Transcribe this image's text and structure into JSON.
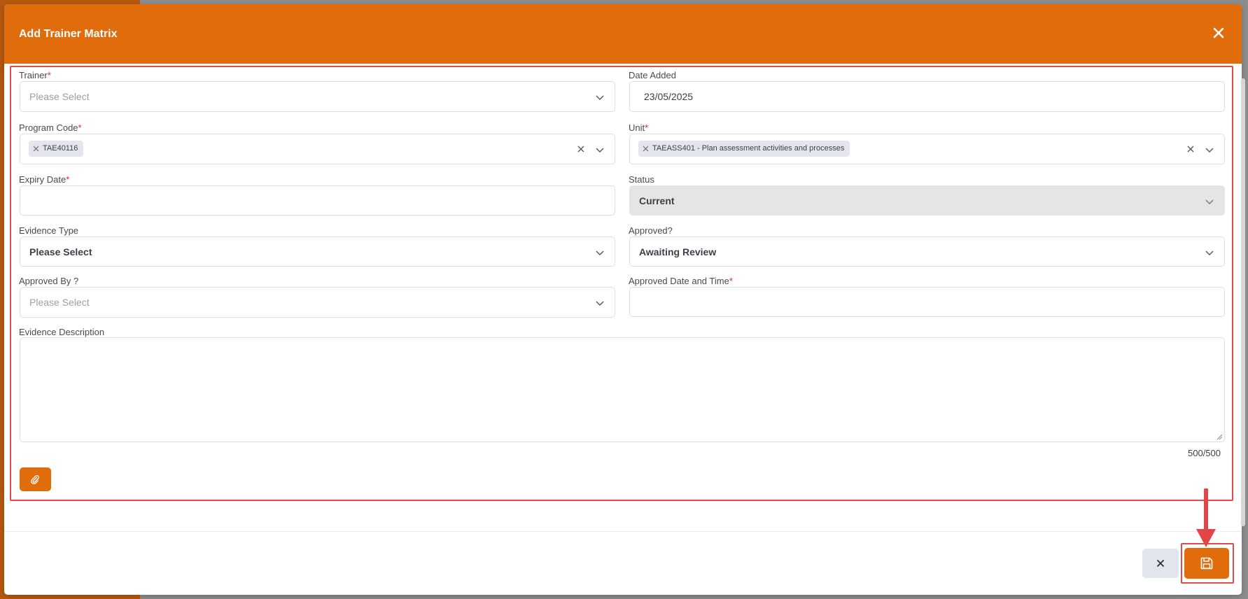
{
  "modal": {
    "title": "Add Trainer Matrix",
    "close_icon": "close-icon"
  },
  "form": {
    "trainer": {
      "label": "Trainer",
      "required_mark": "*",
      "placeholder": "Please Select"
    },
    "date_added": {
      "label": "Date Added",
      "value": "23/05/2025"
    },
    "program_code": {
      "label": "Program Code",
      "required_mark": "*",
      "chips": [
        "TAE40116"
      ]
    },
    "unit": {
      "label": "Unit",
      "required_mark": "*",
      "chips": [
        "TAEASS401 - Plan assessment activities and processes"
      ]
    },
    "expiry_date": {
      "label": "Expiry Date",
      "required_mark": "*",
      "value": ""
    },
    "status": {
      "label": "Status",
      "value": "Current"
    },
    "evidence_type": {
      "label": "Evidence Type",
      "value": "Please Select"
    },
    "approved": {
      "label": "Approved?",
      "value": "Awaiting Review"
    },
    "approved_by": {
      "label": "Approved By ?",
      "placeholder": "Please Select"
    },
    "approved_datetime": {
      "label": "Approved Date and Time",
      "required_mark": "*",
      "value": ""
    },
    "evidence_description": {
      "label": "Evidence Description",
      "value": "",
      "counter": "500/500"
    }
  },
  "footer": {
    "attach_icon": "paperclip-icon",
    "cancel_icon": "close-icon",
    "save_icon": "save-icon"
  },
  "colors": {
    "accent": "#e06c0c",
    "highlight": "#de4b4b",
    "required": "#e0213a"
  }
}
